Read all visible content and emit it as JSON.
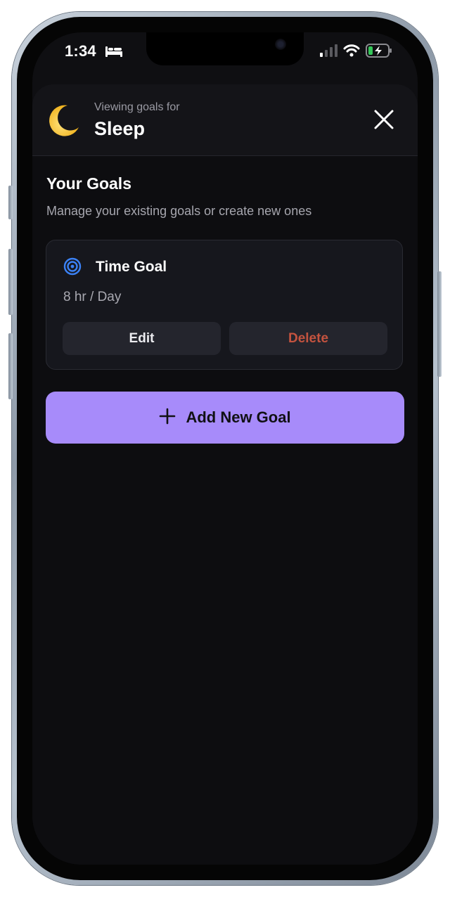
{
  "status_bar": {
    "time": "1:34",
    "focus_icon": "bed-icon",
    "signal_icon": "cellular-signal-icon",
    "wifi_icon": "wifi-icon",
    "battery_icon": "battery-charging-icon"
  },
  "header": {
    "viewing_label": "Viewing goals for",
    "activity_name": "Sleep",
    "activity_icon": "crescent-moon-icon",
    "close_icon": "close-icon"
  },
  "section": {
    "title": "Your Goals",
    "subtitle": "Manage your existing goals or create new ones"
  },
  "goals": [
    {
      "type": "Time Goal",
      "value": "8 hr / Day",
      "icon": "target-icon",
      "edit_label": "Edit",
      "delete_label": "Delete"
    }
  ],
  "add_button": {
    "label": "Add New Goal",
    "icon": "plus-icon"
  },
  "colors": {
    "accent": "#a78bfa",
    "danger": "#c4533f",
    "target_blue": "#3b82f6",
    "background": "#0d0d10",
    "card": "#16171d"
  }
}
